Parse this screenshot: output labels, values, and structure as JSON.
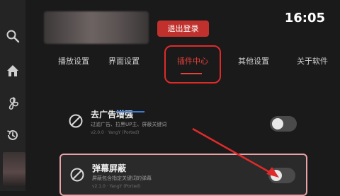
{
  "header": {
    "logout_label": "退出登录",
    "time": "16:05"
  },
  "tabs": [
    {
      "label": "播放设置"
    },
    {
      "label": "界面设置"
    },
    {
      "label": "插件中心"
    },
    {
      "label": "其他设置"
    },
    {
      "label": "关于软件"
    }
  ],
  "active_tab": "插件中心",
  "plugins": [
    {
      "title": "去广告增强",
      "description": "过滤广告、拉黑UP主、屏蔽关键词",
      "version": "v2.0.0 · YangY (Ported)",
      "enabled": false
    },
    {
      "title": "弹幕屏蔽",
      "description": "屏蔽包含指定关键词的弹幕",
      "version": "v2.1.0 · YangY (Ported)",
      "enabled": false
    }
  ],
  "sidebar": {
    "icons": [
      "search-icon",
      "home-icon",
      "fan-icon",
      "history-icon"
    ]
  },
  "colors": {
    "accent": "#e8413b",
    "logout_bg": "#c0312d",
    "annotation": "#e02a2a"
  }
}
